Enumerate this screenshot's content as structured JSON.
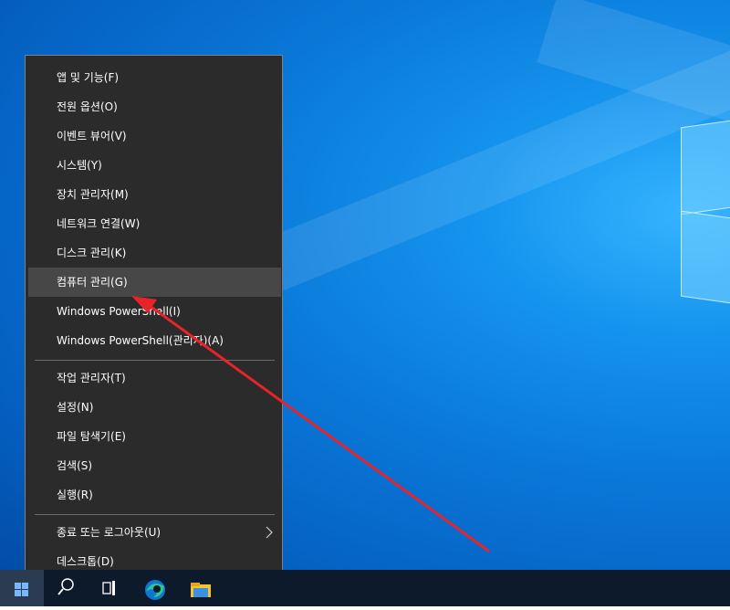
{
  "context_menu": {
    "group1": [
      {
        "label": "앱 및 기능(F)"
      },
      {
        "label": "전원 옵션(O)"
      },
      {
        "label": "이벤트 뷰어(V)"
      },
      {
        "label": "시스템(Y)"
      },
      {
        "label": "장치 관리자(M)"
      },
      {
        "label": "네트워크 연결(W)"
      },
      {
        "label": "디스크 관리(K)"
      },
      {
        "label": "컴퓨터 관리(G)",
        "highlighted": true
      },
      {
        "label": "Windows PowerShell(I)"
      },
      {
        "label": "Windows PowerShell(관리자)(A)"
      }
    ],
    "group2": [
      {
        "label": "작업 관리자(T)"
      },
      {
        "label": "설정(N)"
      },
      {
        "label": "파일 탐색기(E)"
      },
      {
        "label": "검색(S)"
      },
      {
        "label": "실행(R)"
      }
    ],
    "group3": [
      {
        "label": "종료 또는 로그아웃(U)",
        "has_submenu": true
      },
      {
        "label": "데스크톱(D)"
      }
    ]
  },
  "taskbar": {
    "icons": [
      "windows-start-icon",
      "search-icon",
      "task-view-icon",
      "edge-icon",
      "file-explorer-icon"
    ]
  },
  "annotation": {
    "type": "red-arrow",
    "color": "#e8232a",
    "points_to": "컴퓨터 관리(G)"
  },
  "colors": {
    "menu_bg": "#2b2b2b",
    "menu_hover": "#474747",
    "taskbar_bg": "#0c1a2b",
    "desktop": "#0a78d8"
  }
}
